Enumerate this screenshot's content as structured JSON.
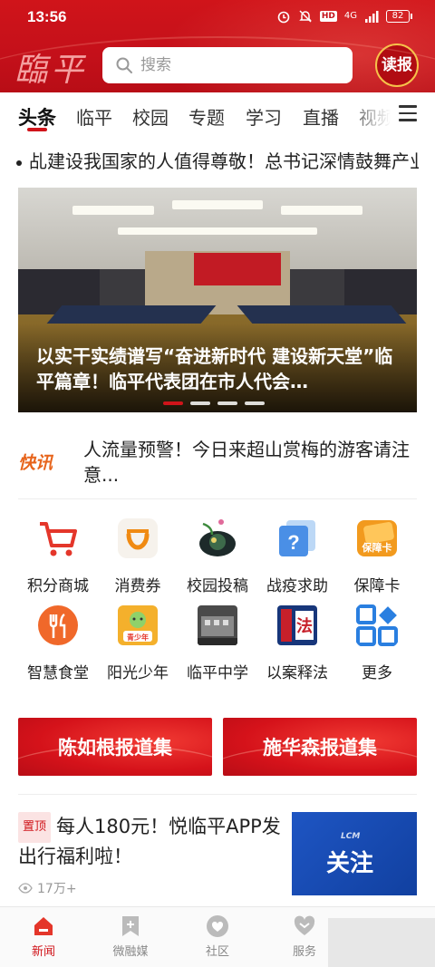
{
  "status_bar": {
    "time": "13:56",
    "network": "4G",
    "battery": "82"
  },
  "header": {
    "logo": "臨平",
    "search_placeholder": "搜索",
    "read_button": "读报"
  },
  "tabs": [
    {
      "label": "头条",
      "active": true
    },
    {
      "label": "临平",
      "active": false
    },
    {
      "label": "校园",
      "active": false
    },
    {
      "label": "专题",
      "active": false
    },
    {
      "label": "学习",
      "active": false
    },
    {
      "label": "直播",
      "active": false
    },
    {
      "label": "视频",
      "active": false
    }
  ],
  "ticker": {
    "text": "乩建设我国家的人值得尊敬！总书记深情鼓舞产业"
  },
  "hero": {
    "caption": "以实干实绩谱写“奋进新时代 建设新天堂”临平篇章！临平代表团在市人代会…",
    "dots": 4,
    "active_dot": 0
  },
  "flash_news": {
    "badge": "快讯",
    "text": "人流量预警！今日来超山赏梅的游客请注意..."
  },
  "services": [
    {
      "label": "积分商城",
      "icon": "cart-icon"
    },
    {
      "label": "消费券",
      "icon": "coupon-icon"
    },
    {
      "label": "校园投稿",
      "icon": "school-submission-icon"
    },
    {
      "label": "战疫求助",
      "icon": "help-icon"
    },
    {
      "label": "保障卡",
      "icon": "security-card-icon"
    },
    {
      "label": "智慧食堂",
      "icon": "canteen-icon"
    },
    {
      "label": "阳光少年",
      "icon": "youth-icon"
    },
    {
      "label": "临平中学",
      "icon": "middle-school-icon"
    },
    {
      "label": "以案释法",
      "icon": "law-icon"
    },
    {
      "label": "更多",
      "icon": "more-apps-icon"
    }
  ],
  "service_icon_text": {
    "coupon": "保障卡",
    "youth": "青少年",
    "law": "法"
  },
  "promos": [
    {
      "label": "陈如根报道集"
    },
    {
      "label": "施华森报道集"
    }
  ],
  "article": {
    "pin_label": "置顶",
    "title": "每人180元！悦临平APP发出行福利啦！",
    "views": "17万+",
    "thumb_small": "LCM",
    "thumb_text": "关注"
  },
  "bottom_nav": [
    {
      "label": "新闻",
      "icon": "news-icon",
      "active": true
    },
    {
      "label": "微融媒",
      "icon": "media-icon",
      "active": false
    },
    {
      "label": "社区",
      "icon": "community-icon",
      "active": false
    },
    {
      "label": "服务",
      "icon": "service-heart-icon",
      "active": false
    }
  ],
  "colors": {
    "brand_red": "#d0141a",
    "flash_orange": "#e7641b",
    "gold": "#f6c24a"
  }
}
